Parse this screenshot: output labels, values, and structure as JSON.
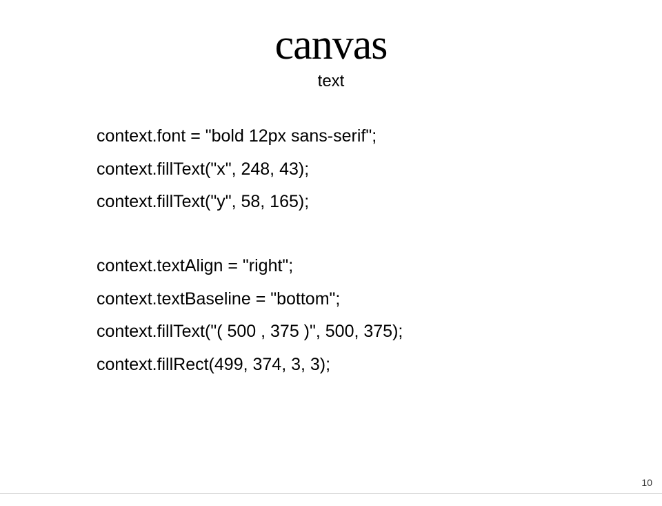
{
  "header": {
    "title": "canvas",
    "subtitle": "text"
  },
  "code": {
    "block1": [
      "context.font = \"bold 12px sans-serif\";",
      "context.fillText(\"x\", 248, 43);",
      "context.fillText(\"y\", 58, 165);"
    ],
    "block2": [
      "context.textAlign = \"right\";",
      "context.textBaseline = \"bottom\";",
      "context.fillText(\"( 500 , 375 )\", 500, 375);",
      "context.fillRect(499, 374, 3, 3);"
    ]
  },
  "page_number": "10"
}
